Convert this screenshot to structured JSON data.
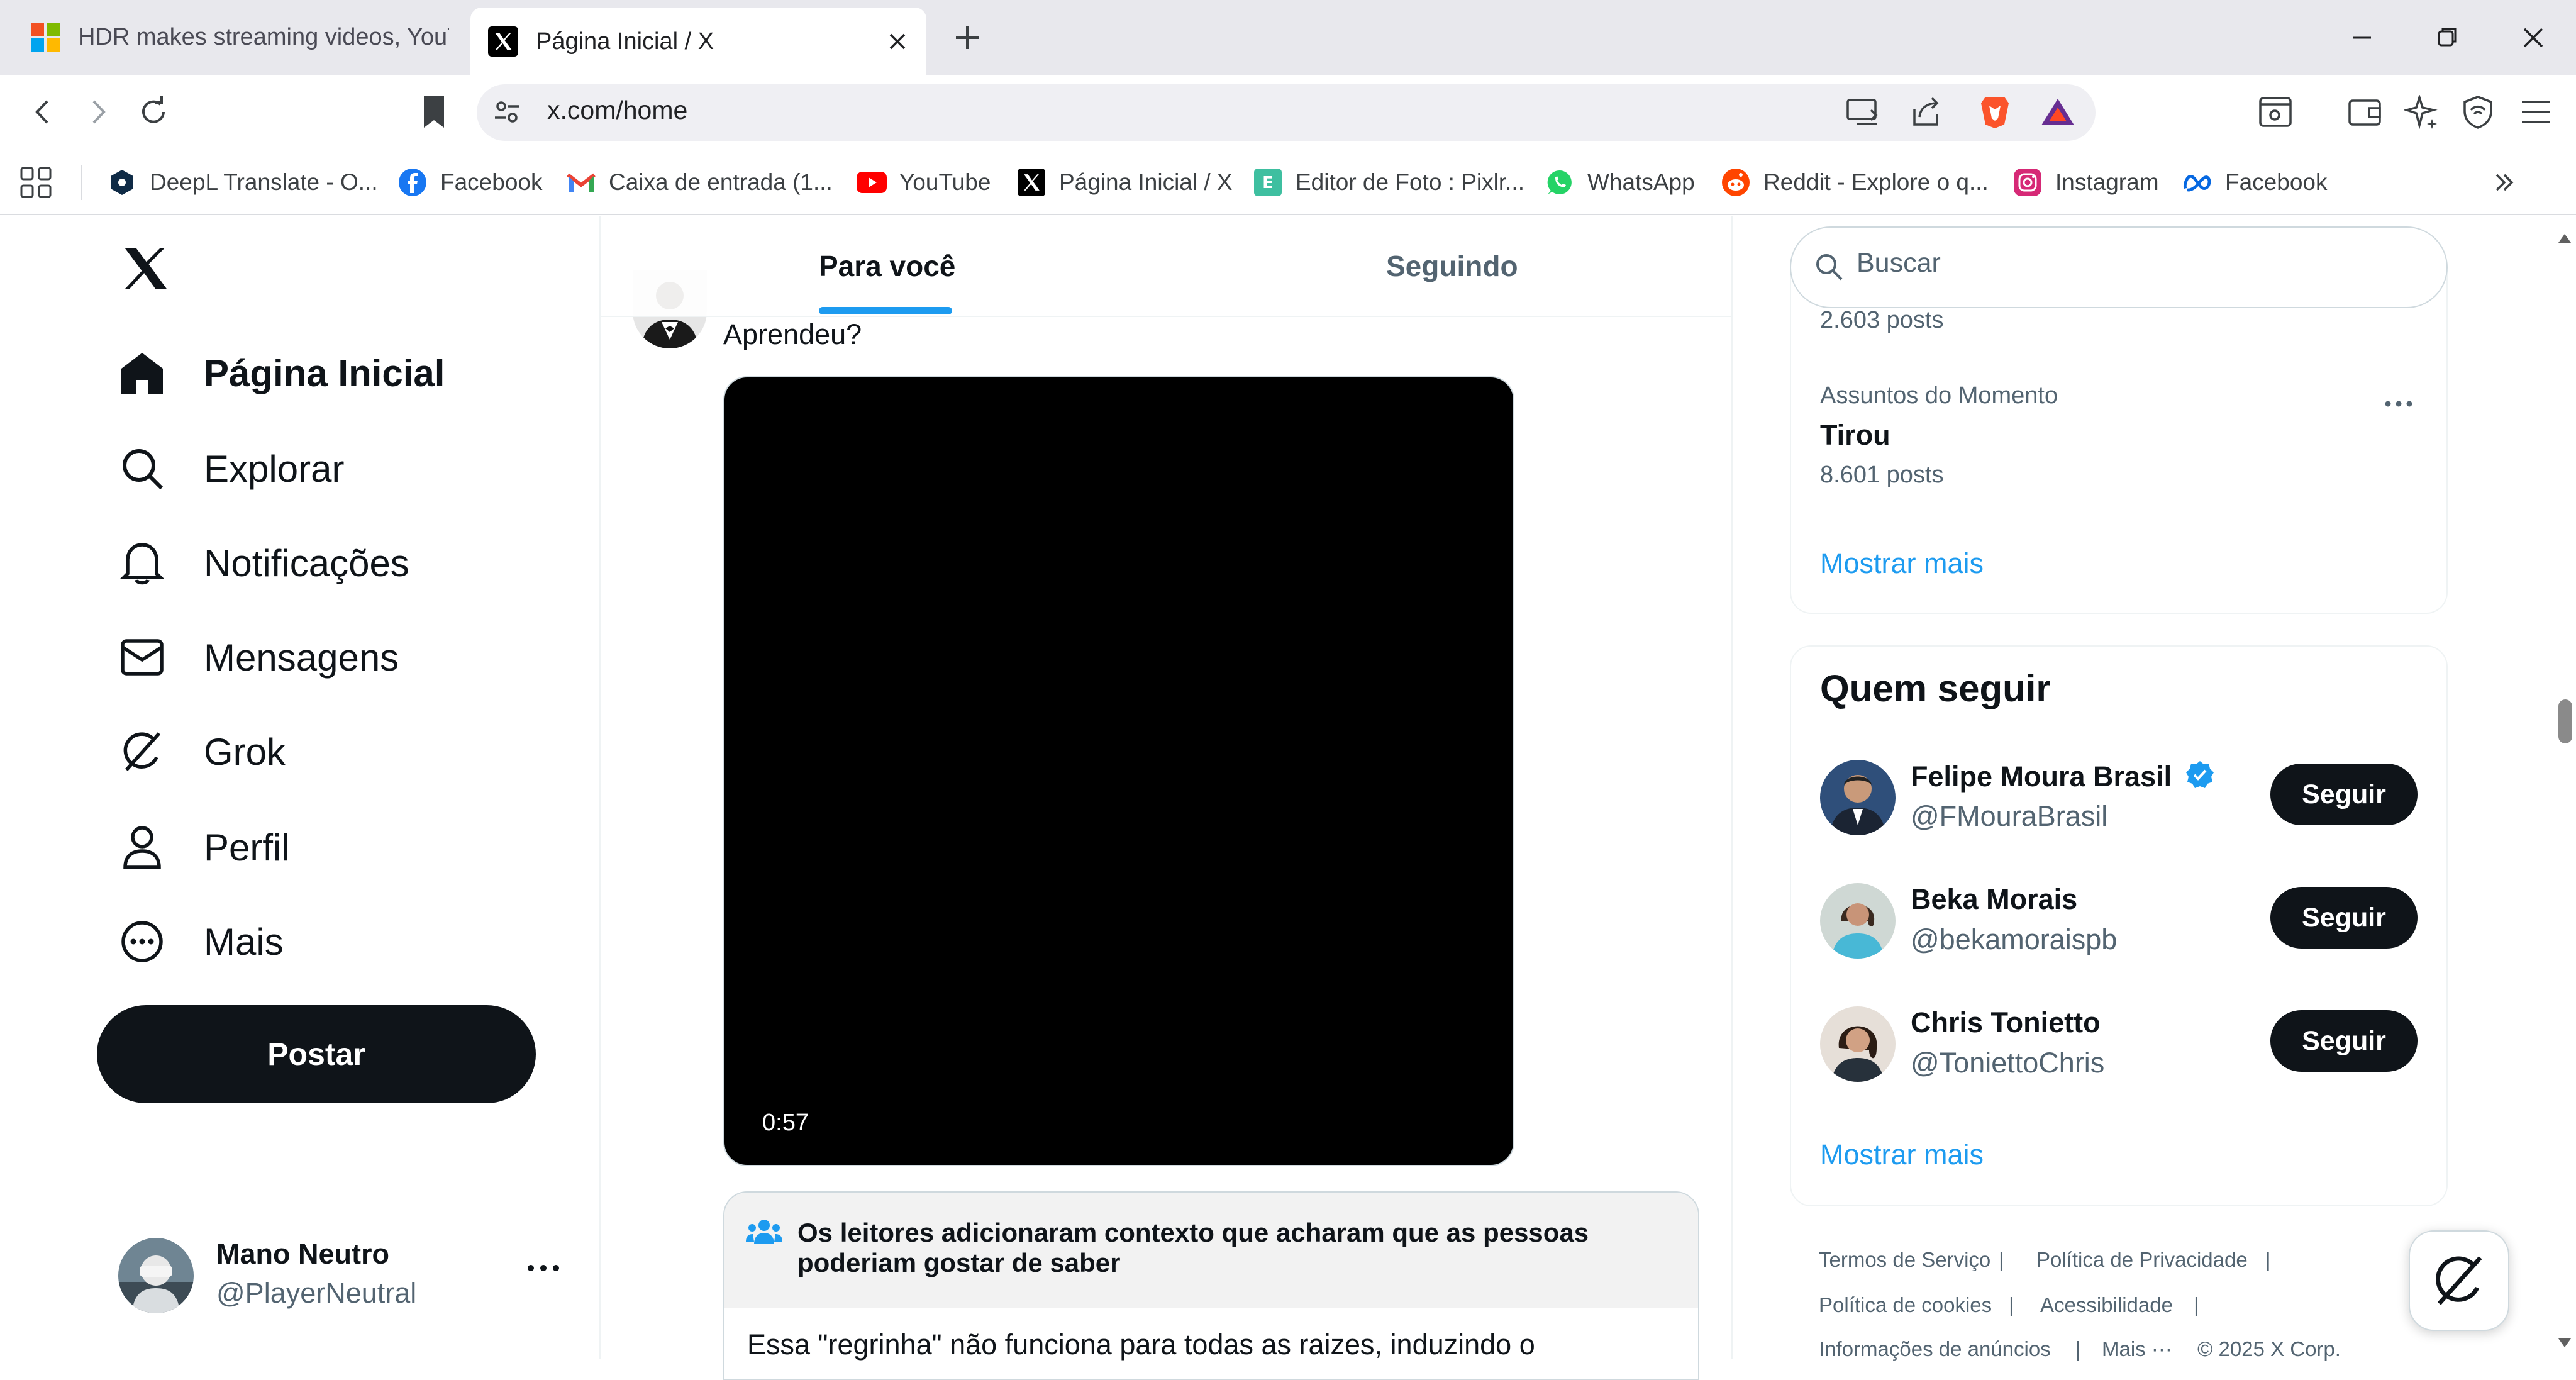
{
  "browser": {
    "tabs": [
      {
        "title": "HDR makes streaming videos, YouTube",
        "favicon": "windows-logo-icon"
      },
      {
        "title": "Página Inicial / X",
        "favicon": "x-logo-icon",
        "active": true
      }
    ],
    "url": "x.com/home",
    "bookmarks": [
      {
        "label": "DeepL Translate - O...",
        "icon": "deepl-icon"
      },
      {
        "label": "Facebook",
        "icon": "facebook-icon"
      },
      {
        "label": "Caixa de entrada (1...",
        "icon": "gmail-icon"
      },
      {
        "label": "YouTube",
        "icon": "youtube-icon"
      },
      {
        "label": "Página Inicial / X",
        "icon": "x-logo-icon"
      },
      {
        "label": "Editor de Foto : Pixlr...",
        "icon": "pixlr-icon"
      },
      {
        "label": "WhatsApp",
        "icon": "whatsapp-icon"
      },
      {
        "label": "Reddit - Explore o q...",
        "icon": "reddit-icon"
      },
      {
        "label": "Instagram",
        "icon": "instagram-icon"
      },
      {
        "label": "Facebook",
        "icon": "meta-icon"
      }
    ]
  },
  "nav": {
    "items": [
      {
        "label": "Página Inicial",
        "icon": "home-icon"
      },
      {
        "label": "Explorar",
        "icon": "search-icon"
      },
      {
        "label": "Notificações",
        "icon": "bell-icon"
      },
      {
        "label": "Mensagens",
        "icon": "mail-icon"
      },
      {
        "label": "Grok",
        "icon": "grok-icon"
      },
      {
        "label": "Perfil",
        "icon": "person-icon"
      },
      {
        "label": "Mais",
        "icon": "more-circle-icon"
      }
    ],
    "post_label": "Postar"
  },
  "account": {
    "name": "Mano Neutro",
    "handle": "@PlayerNeutral"
  },
  "feed": {
    "tabs": [
      "Para você",
      "Seguindo"
    ],
    "post_text": "Aprendeu?",
    "video_duration": "0:57",
    "community_note_title": "Os leitores adicionaram contexto que acharam que as pessoas poderiam gostar de saber",
    "community_note_text": "Essa \"regrinha\" não funciona para todas as raizes, induzindo o"
  },
  "sidebar": {
    "search_placeholder": "Buscar",
    "trends": {
      "partial_count": "2.603 posts",
      "category": "Assuntos do Momento",
      "name": "Tirou",
      "count": "8.601 posts",
      "show_more": "Mostrar mais"
    },
    "who_to_follow": {
      "title": "Quem seguir",
      "accounts": [
        {
          "name": "Felipe Moura Brasil",
          "handle": "@FMouraBrasil",
          "verified": true,
          "button": "Seguir"
        },
        {
          "name": "Beka Morais",
          "handle": "@bekamoraispb",
          "button": "Seguir"
        },
        {
          "name": "Chris Tonietto",
          "handle": "@ToniettoChris",
          "button": "Seguir"
        }
      ],
      "show_more": "Mostrar mais"
    },
    "footer": [
      "Termos de Serviço",
      "|",
      "Política de Privacidade",
      "|",
      "Política de cookies",
      "|",
      "Acessibilidade",
      "|",
      "Informações de anúncios",
      "|",
      "Mais ···",
      "© 2025 X Corp."
    ]
  },
  "colors": {
    "accent": "#1d9bf0",
    "text": "#0f1419",
    "muted": "#536471"
  }
}
